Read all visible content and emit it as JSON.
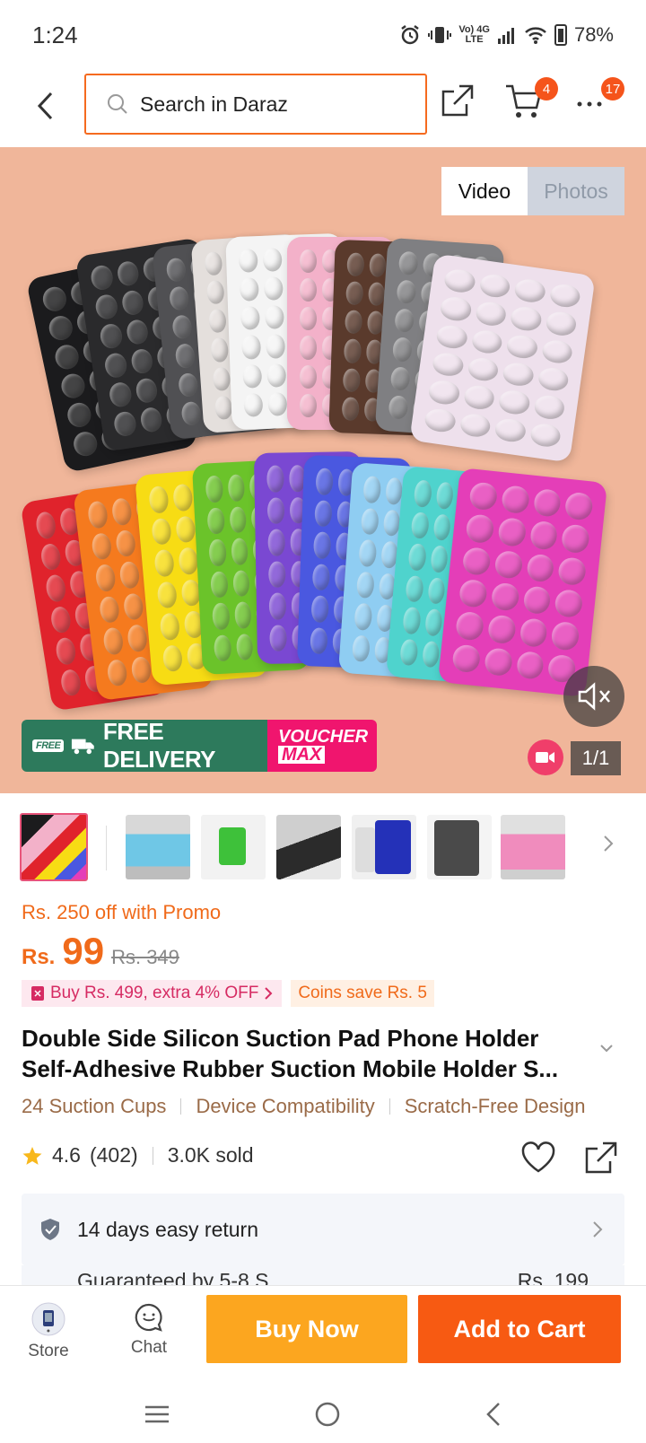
{
  "status_bar": {
    "time": "1:24",
    "network_top": "Vo) 4G",
    "network_bottom": "LTE",
    "battery": "78%"
  },
  "header": {
    "search_placeholder": "Search in Daraz",
    "cart_badge": "4",
    "more_badge": "17"
  },
  "hero": {
    "tabs": [
      {
        "label": "Video",
        "active": true
      },
      {
        "label": "Photos",
        "active": false
      }
    ],
    "banner_free_tag": "FREE",
    "banner_left": "FREE DELIVERY",
    "banner_right_top": "VOUCHER",
    "banner_right_bottom": "MAX",
    "counter": "1/1"
  },
  "pricing": {
    "promo": "Rs. 250 off with Promo",
    "currency": "Rs.",
    "price": "99",
    "old_price": "Rs. 349",
    "tag_bundle": "Buy Rs. 499, extra 4% OFF",
    "tag_coins": "Coins save Rs. 5"
  },
  "product": {
    "title_line1": "Double Side Silicon Suction Pad Phone Holder",
    "title_line2": "Self-Adhesive Rubber Suction Mobile Holder S...",
    "features": [
      "24 Suction Cups",
      "Device Compatibility",
      "Scratch-Free Design"
    ],
    "rating": "4.6",
    "reviews": "(402)",
    "sold": "3.0K sold"
  },
  "service": {
    "return_text": "14 days easy return",
    "peek_left": "Guaranteed by 5-8 S",
    "peek_right": "Rs. 199"
  },
  "action_bar": {
    "store_label": "Store",
    "chat_label": "Chat",
    "buy_now": "Buy Now",
    "add_to_cart": "Add to Cart"
  },
  "colors": {
    "brand_orange": "#f75a12",
    "buy_now": "#fca61f",
    "price": "#f06a1a",
    "free_delivery_green": "#2d7a5c",
    "voucher_pink": "#f0156e"
  },
  "icons": [
    "back-icon",
    "search-icon",
    "share-icon",
    "cart-icon",
    "more-icon",
    "mute-icon",
    "video-icon",
    "star-icon",
    "heart-icon",
    "shield-icon",
    "chat-icon",
    "store-icon"
  ]
}
